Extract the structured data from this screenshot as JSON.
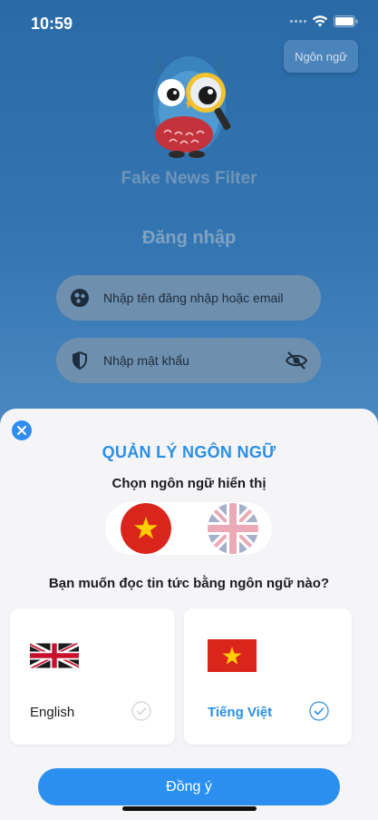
{
  "status_bar": {
    "time": "10:59"
  },
  "header": {
    "language_button": "Ngôn ngữ"
  },
  "app": {
    "name": "Fake News Filter"
  },
  "login": {
    "title": "Đăng nhập",
    "username_placeholder": "Nhập tên đăng nhập hoặc email",
    "password_placeholder": "Nhập mật khẩu"
  },
  "language_sheet": {
    "title": "QUẢN LÝ NGÔN NGỮ",
    "display_language_prompt": "Chọn ngôn ngữ hiển thị",
    "display_language_selected": "vi",
    "news_language_prompt": "Bạn muốn đọc tin tức bằng ngôn ngữ nào?",
    "options": [
      {
        "label": "English",
        "flag": "uk-flag-icon",
        "selected": false
      },
      {
        "label": "Tiếng Việt",
        "flag": "vietnam-flag-icon",
        "selected": true
      }
    ],
    "confirm_button": "Đồng ý"
  },
  "colors": {
    "accent": "#2b8ff0",
    "title_blue": "#2b8fe6",
    "sheet_bg": "#f5f5f7",
    "vn_red": "#da251d",
    "vn_star": "#ffcd00"
  }
}
